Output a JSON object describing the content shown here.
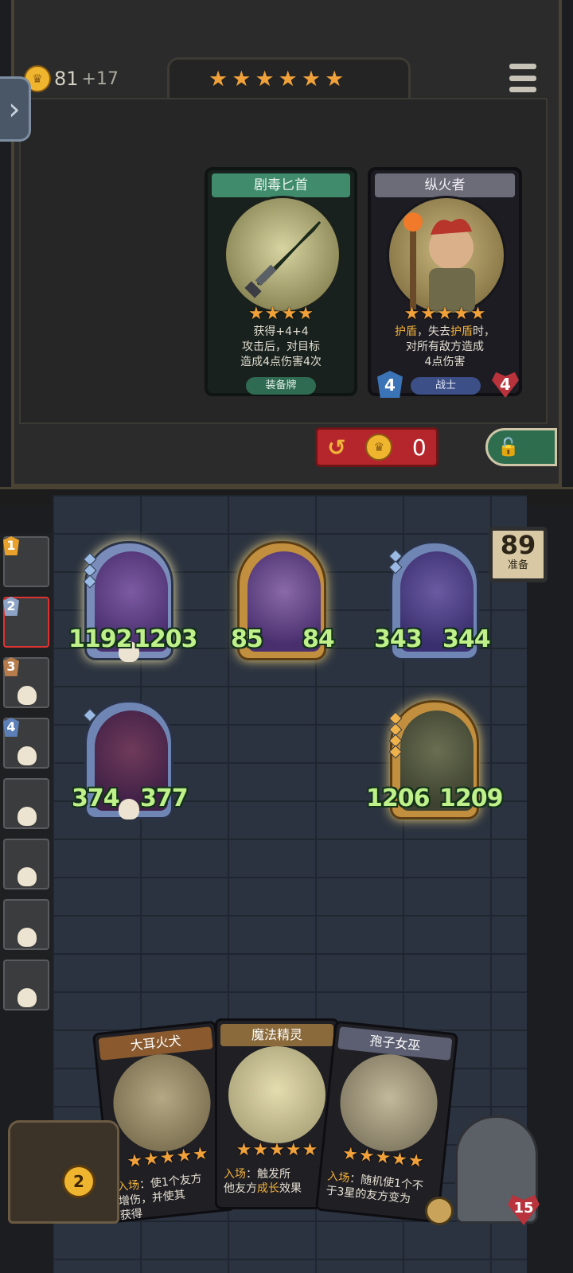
{
  "top_bar": {
    "gold": "81",
    "gold_income": "+17",
    "tier_stars": 6
  },
  "shop": {
    "cards": [
      {
        "name": "剧毒匕首",
        "stars": 4,
        "desc_lines": [
          "获得+4+4",
          "攻击后，对目标",
          "造成4点伤害4次"
        ],
        "type": "装备牌"
      },
      {
        "name": "纵火者",
        "stars": 5,
        "desc_lines_1_a": "护盾",
        "desc_lines_1_b": "，失去",
        "desc_lines_1_c": "护盾",
        "desc_lines_1_d": "时，",
        "desc_line2": "对所有敌方造成",
        "desc_line3": "4点伤害",
        "attack": "4",
        "health": "4",
        "type": "战士"
      }
    ],
    "refresh_cost": "0"
  },
  "timer": {
    "value": "89",
    "label": "准备"
  },
  "board": {
    "units": [
      {
        "attack": "1192",
        "health": "1203"
      },
      {
        "attack": "85",
        "health": "84"
      },
      {
        "attack": "343",
        "health": "344"
      },
      {
        "attack": "374",
        "health": "377"
      },
      {
        "attack": "1206",
        "health": "1209"
      }
    ]
  },
  "opponents": [
    {
      "rank": "1",
      "color": "#e8a12a"
    },
    {
      "rank": "2",
      "color": "#8da4c6"
    },
    {
      "rank": "3",
      "color": "#b67c4c"
    },
    {
      "rank": "4",
      "color": "#5c7fb8"
    }
  ],
  "hand": [
    {
      "name": "大耳火犬",
      "stars": 5,
      "line1_kw": "入场",
      "line1": "：使1个友方",
      "line2": "增伤，并使其",
      "line3": "获得"
    },
    {
      "name": "魔法精灵",
      "stars": 5,
      "line1_kw": "入场",
      "line1": "：触发所",
      "line2_a": "他友方",
      "line2_kw": "成长",
      "line2_b": "效果"
    },
    {
      "name": "孢子女巫",
      "stars": 5,
      "line1_kw": "入场",
      "line1": "：随机使1个不",
      "line2": "于3星的友方变为"
    }
  ],
  "bottom": {
    "chest_count": "2",
    "hero_health": "15"
  }
}
